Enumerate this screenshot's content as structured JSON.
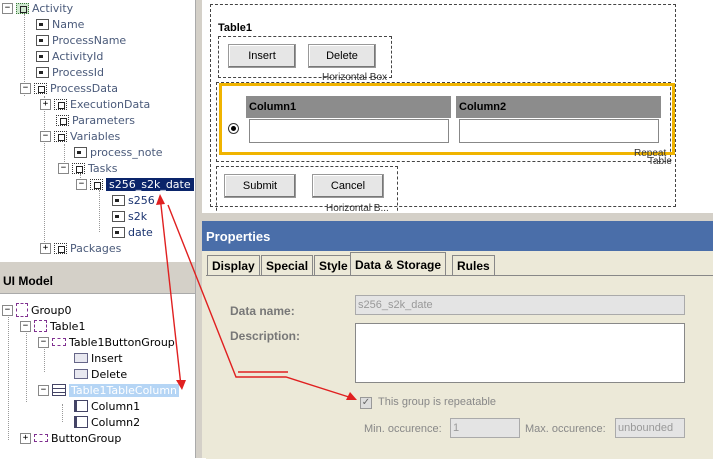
{
  "data_tree": {
    "root": "Activity",
    "fields": [
      "Name",
      "ProcessName",
      "ActivityId",
      "ProcessId"
    ],
    "process_data": "ProcessData",
    "process_children": [
      "ExecutionData",
      "Parameters",
      "Variables"
    ],
    "variables_child": "process_note",
    "tasks": "Tasks",
    "selected_group": "s256_s2k_date",
    "selected_children": [
      "s256",
      "s2k",
      "date"
    ],
    "packages": "Packages"
  },
  "ui_model": {
    "title": "UI Model",
    "group0": "Group0",
    "table1": "Table1",
    "button_group_node": "Table1ButtonGroup",
    "button_children": [
      "Insert",
      "Delete"
    ],
    "table_column_node": "Table1TableColumn",
    "column_children": [
      "Column1",
      "Column2"
    ],
    "button_group": "ButtonGroup"
  },
  "canvas": {
    "table_title": "Table1",
    "insert_label": "Insert",
    "delete_label": "Delete",
    "hbox_label": "Horizontal Box",
    "col1": "Column1",
    "col2": "Column2",
    "repeat_label_1": "Repeat",
    "repeat_label_2": "Table",
    "submit_label": "Submit",
    "cancel_label": "Cancel",
    "hbox2_label": "Horizontal B..."
  },
  "properties": {
    "title": "Properties",
    "tabs": [
      "Display",
      "Special",
      "Style",
      "Data & Storage",
      "Rules"
    ],
    "active_tab": "Data & Storage",
    "data_name_label": "Data name:",
    "data_name_value": "s256_s2k_date",
    "description_label": "Description:",
    "repeatable_label": "This group is repeatable",
    "min_label": "Min. occurence:",
    "min_value": "1",
    "max_label": "Max. occurence:",
    "max_value": "unbounded"
  },
  "colors": {
    "selection": "#0a246a",
    "highlight_box": "#f0b400",
    "arrow": "#e02020",
    "properties_header": "#4a6ea9"
  }
}
